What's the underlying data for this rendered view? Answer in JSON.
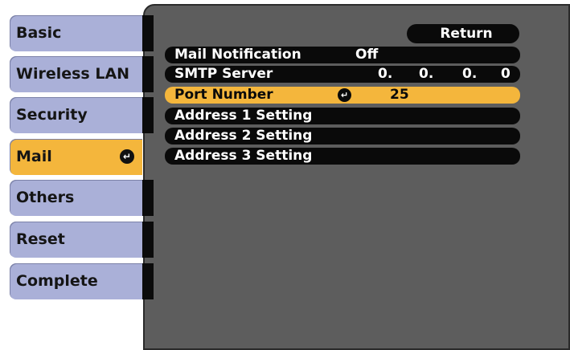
{
  "sidebar": {
    "items": [
      {
        "label": "Basic"
      },
      {
        "label": "Wireless LAN"
      },
      {
        "label": "Security"
      },
      {
        "label": "Mail",
        "enter_glyph": "↵"
      },
      {
        "label": "Others"
      },
      {
        "label": "Reset"
      },
      {
        "label": "Complete"
      }
    ]
  },
  "panel": {
    "return_label": "Return",
    "rows": [
      {
        "label": "Mail Notification",
        "value": "Off"
      },
      {
        "label": "SMTP Server",
        "ip": [
          "0.",
          "0.",
          "0.",
          "0"
        ]
      },
      {
        "label": "Port Number",
        "value": "25",
        "enter_glyph": "↵"
      },
      {
        "label": "Address 1 Setting"
      },
      {
        "label": "Address 2 Setting"
      },
      {
        "label": "Address 3 Setting"
      }
    ]
  },
  "colors": {
    "tab": "#aab0d8",
    "accent": "#f4b63c",
    "panel": "#5d5d5d",
    "row": "#0a0a0a"
  }
}
